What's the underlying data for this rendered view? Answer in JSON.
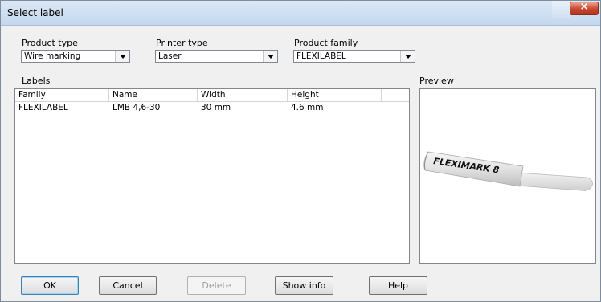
{
  "window": {
    "title": "Select label",
    "close_glyph": "×"
  },
  "filters": {
    "product_type": {
      "label": "Product type",
      "value": "Wire marking"
    },
    "printer_type": {
      "label": "Printer type",
      "value": "Laser"
    },
    "product_family": {
      "label": "Product family",
      "value": "FLEXILABEL"
    }
  },
  "labels": {
    "heading": "Labels",
    "columns": [
      "Family",
      "Name",
      "Width",
      "Height"
    ],
    "rows": [
      {
        "family": "FLEXILABEL",
        "name": "LMB 4,6-30",
        "width": "30 mm",
        "height": "4.6 mm"
      }
    ]
  },
  "preview": {
    "heading": "Preview",
    "image_text": "FLEXIMARK 8"
  },
  "buttons": {
    "ok": "OK",
    "cancel": "Cancel",
    "delete": "Delete",
    "show_info": "Show info",
    "help": "Help"
  },
  "icons": {
    "close": "close-icon",
    "dropdown": "chevron-down-icon"
  }
}
